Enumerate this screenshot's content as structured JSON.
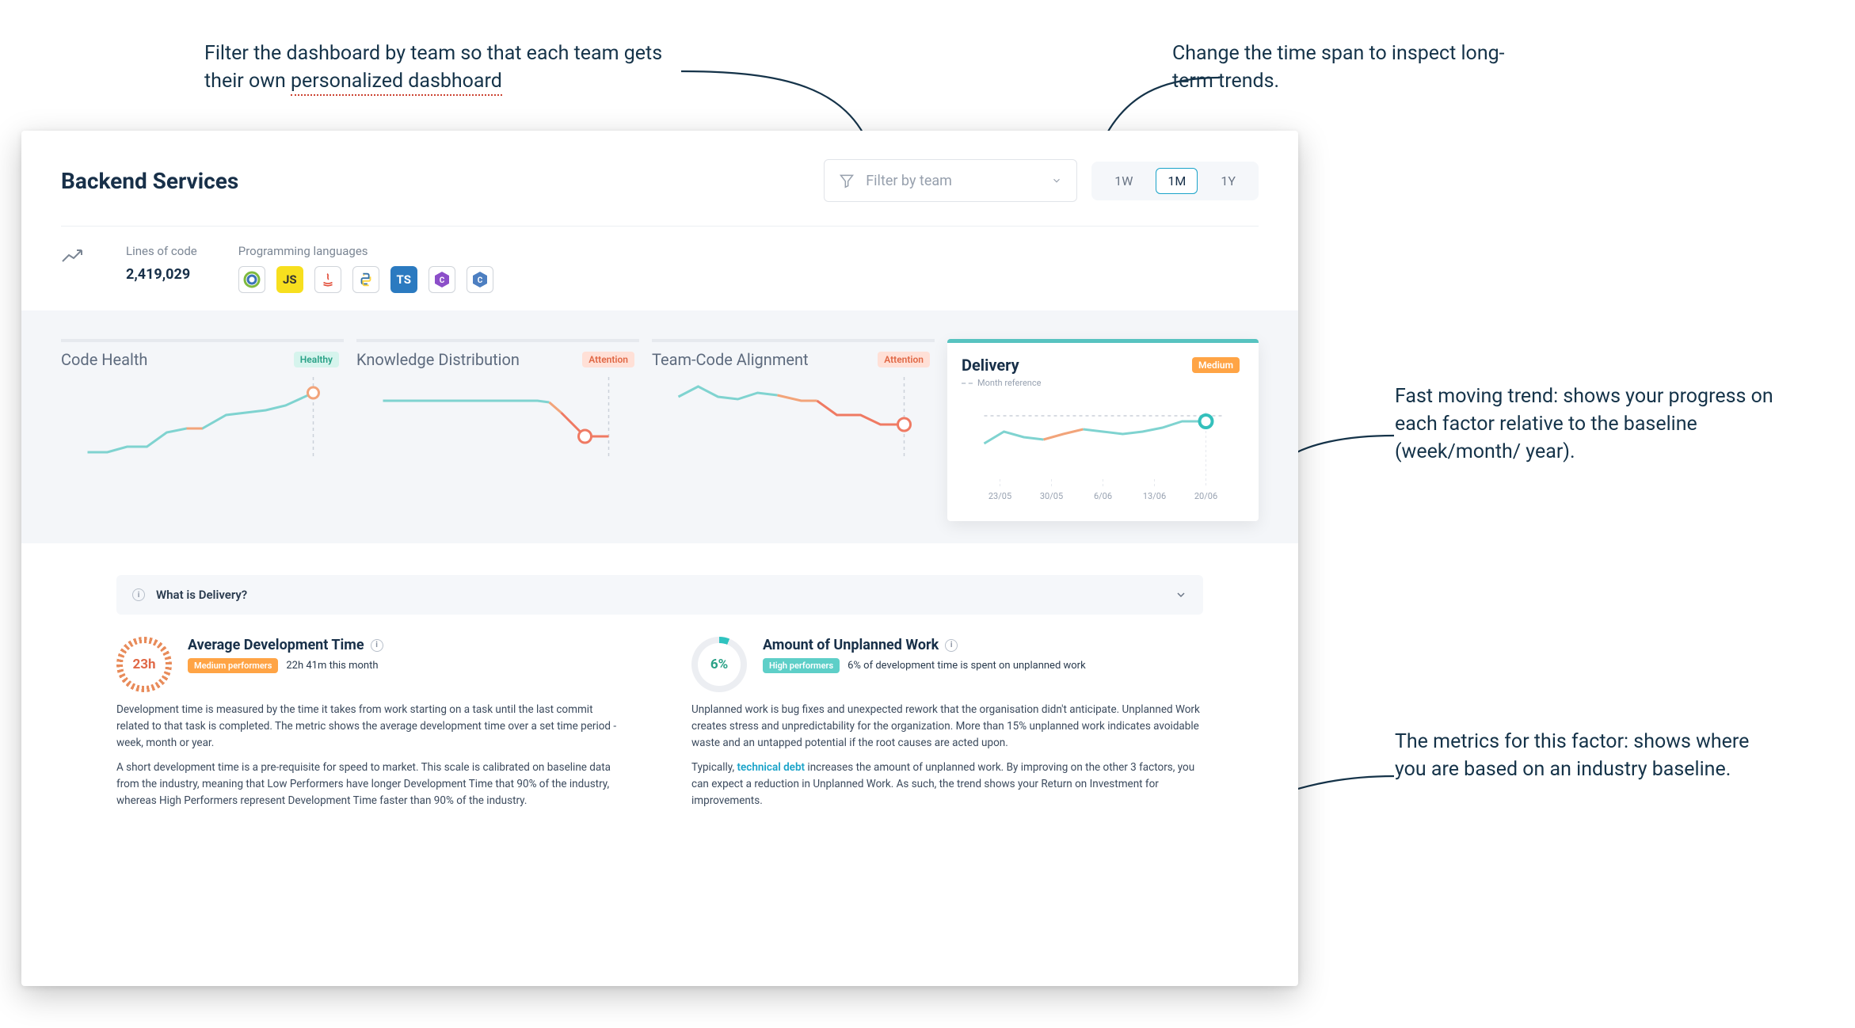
{
  "annotations": {
    "top_left": "Filter the dashboard by team so that each team gets their own personalized dasbhoard",
    "top_left_underlined": "personalized dasbhoard",
    "top_right": "Change the time span to inspect long-term trends.",
    "mid_right": "Fast moving trend: shows your progress on each factor relative to the baseline (week/month/ year).",
    "bot_right": "The metrics for this factor: shows where you are based on an industry baseline."
  },
  "header": {
    "title": "Backend Services",
    "filter_placeholder": "Filter by team",
    "timespan_options": [
      "1W",
      "1M",
      "1Y"
    ],
    "timespan_selected": "1M"
  },
  "summary": {
    "lines_of_code_label": "Lines of code",
    "lines_of_code_value": "2,419,029",
    "languages_label": "Programming languages",
    "languages": [
      {
        "name": "clojure",
        "label": ""
      },
      {
        "name": "javascript",
        "label": "JS"
      },
      {
        "name": "java",
        "label": ""
      },
      {
        "name": "python",
        "label": ""
      },
      {
        "name": "typescript",
        "label": "TS"
      },
      {
        "name": "csharp",
        "label": ""
      },
      {
        "name": "cpp",
        "label": ""
      }
    ]
  },
  "tiles": [
    {
      "id": "code-health",
      "title": "Code Health",
      "badge": "Healthy",
      "badge_class": "badge-healthy"
    },
    {
      "id": "knowledge-distribution",
      "title": "Knowledge Distribution",
      "badge": "Attention",
      "badge_class": "badge-attention"
    },
    {
      "id": "team-code-alignment",
      "title": "Team-Code Alignment",
      "badge": "Attention",
      "badge_class": "badge-attention"
    },
    {
      "id": "delivery",
      "title": "Delivery",
      "badge": "Medium",
      "badge_class": "badge-medium",
      "selected": true,
      "month_reference_label": "Month reference"
    }
  ],
  "delivery_axis_labels": [
    "23/05",
    "30/05",
    "6/06",
    "13/06",
    "20/06"
  ],
  "accordion": {
    "label": "What is Delivery?"
  },
  "metrics": {
    "avg_dev_time": {
      "gauge": "23h",
      "title": "Average Development Time",
      "perf_badge": "Medium performers",
      "sub_text": "22h 41m this month",
      "p1": "Development time is measured by the time it takes from work starting on a task until the last commit related to that task is completed. The metric shows the average development time over a set time period - week, month or year.",
      "p2": "A short development time is a pre-requisite for speed to market. This scale is calibrated on baseline data from the industry, meaning that Low Performers have longer Development Time that 90% of the industry, whereas High Performers represent Development Time faster than 90% of the industry."
    },
    "unplanned_work": {
      "gauge": "6%",
      "title": "Amount of Unplanned Work",
      "perf_badge": "High performers",
      "sub_text": "6% of development time is spent on unplanned work",
      "p1": "Unplanned work is bug fixes and unexpected rework that the organisation didn't anticipate. Unplanned Work creates stress and unpredictability for the organization. More than 15% unplanned work indicates avoidable waste and an untapped potential if the root causes are acted upon.",
      "p2_pre": "Typically, ",
      "p2_link": "technical debt",
      "p2_post": " increases the amount of unplanned work. By improving on the other 3 factors, you can expect a reduction in Unplanned Work. As such, the trend shows your Return on Investment for improvements."
    }
  },
  "chart_data": [
    {
      "id": "code-health",
      "type": "line",
      "title": "Code Health",
      "status": "Healthy",
      "x": [
        0,
        1,
        2,
        3,
        4,
        5,
        6,
        7,
        8,
        9,
        10,
        11
      ],
      "y": [
        10,
        10,
        12,
        12,
        18,
        20,
        20,
        26,
        27,
        28,
        30,
        34
      ],
      "segment_status": [
        "good",
        "good",
        "good",
        "good",
        "good",
        "warn",
        "good",
        "good",
        "good",
        "good",
        "good"
      ],
      "marker_at": 11,
      "xlabel": "",
      "ylabel": "",
      "ylim": [
        0,
        40
      ]
    },
    {
      "id": "knowledge-distribution",
      "type": "line",
      "title": "Knowledge Distribution",
      "status": "Attention",
      "x": [
        0,
        1,
        2,
        3,
        4,
        5,
        6,
        7,
        8,
        9,
        10,
        11
      ],
      "y": [
        28,
        28,
        28,
        28,
        28,
        28,
        28,
        28,
        27,
        22,
        14,
        14
      ],
      "segment_status": [
        "good",
        "good",
        "good",
        "good",
        "good",
        "good",
        "good",
        "good",
        "warn",
        "bad",
        "bad"
      ],
      "marker_at": 11,
      "xlabel": "",
      "ylabel": "",
      "ylim": [
        0,
        40
      ]
    },
    {
      "id": "team-code-alignment",
      "type": "line",
      "title": "Team-Code Alignment",
      "status": "Attention",
      "x": [
        0,
        1,
        2,
        3,
        4,
        5,
        6,
        7,
        8,
        9,
        10,
        11
      ],
      "y": [
        30,
        34,
        30,
        29,
        32,
        31,
        28,
        28,
        22,
        22,
        18,
        18
      ],
      "segment_status": [
        "good",
        "good",
        "good",
        "good",
        "good",
        "warn",
        "warn",
        "bad",
        "bad",
        "bad",
        "bad"
      ],
      "marker_at": 11,
      "xlabel": "",
      "ylabel": "",
      "ylim": [
        0,
        40
      ]
    },
    {
      "id": "delivery",
      "type": "line",
      "title": "Delivery",
      "status": "Medium",
      "categories": [
        "23/05",
        "30/05",
        "6/06",
        "13/06",
        "20/06"
      ],
      "y": [
        26,
        30,
        28,
        27,
        30,
        32,
        31,
        30,
        31,
        33,
        35,
        35
      ],
      "segment_status": [
        "good",
        "good",
        "warn",
        "warn",
        "good",
        "good",
        "good",
        "good",
        "good",
        "good",
        "good"
      ],
      "reference_line": 35,
      "marker_at": 11,
      "xlabel": "",
      "ylabel": "",
      "ylim": [
        0,
        40
      ]
    }
  ],
  "colors": {
    "accent_teal": "#57c3c0",
    "accent_orange": "#ffa445",
    "attention": "#e88b5a",
    "text_dark": "#183049",
    "muted": "#7b8694"
  }
}
